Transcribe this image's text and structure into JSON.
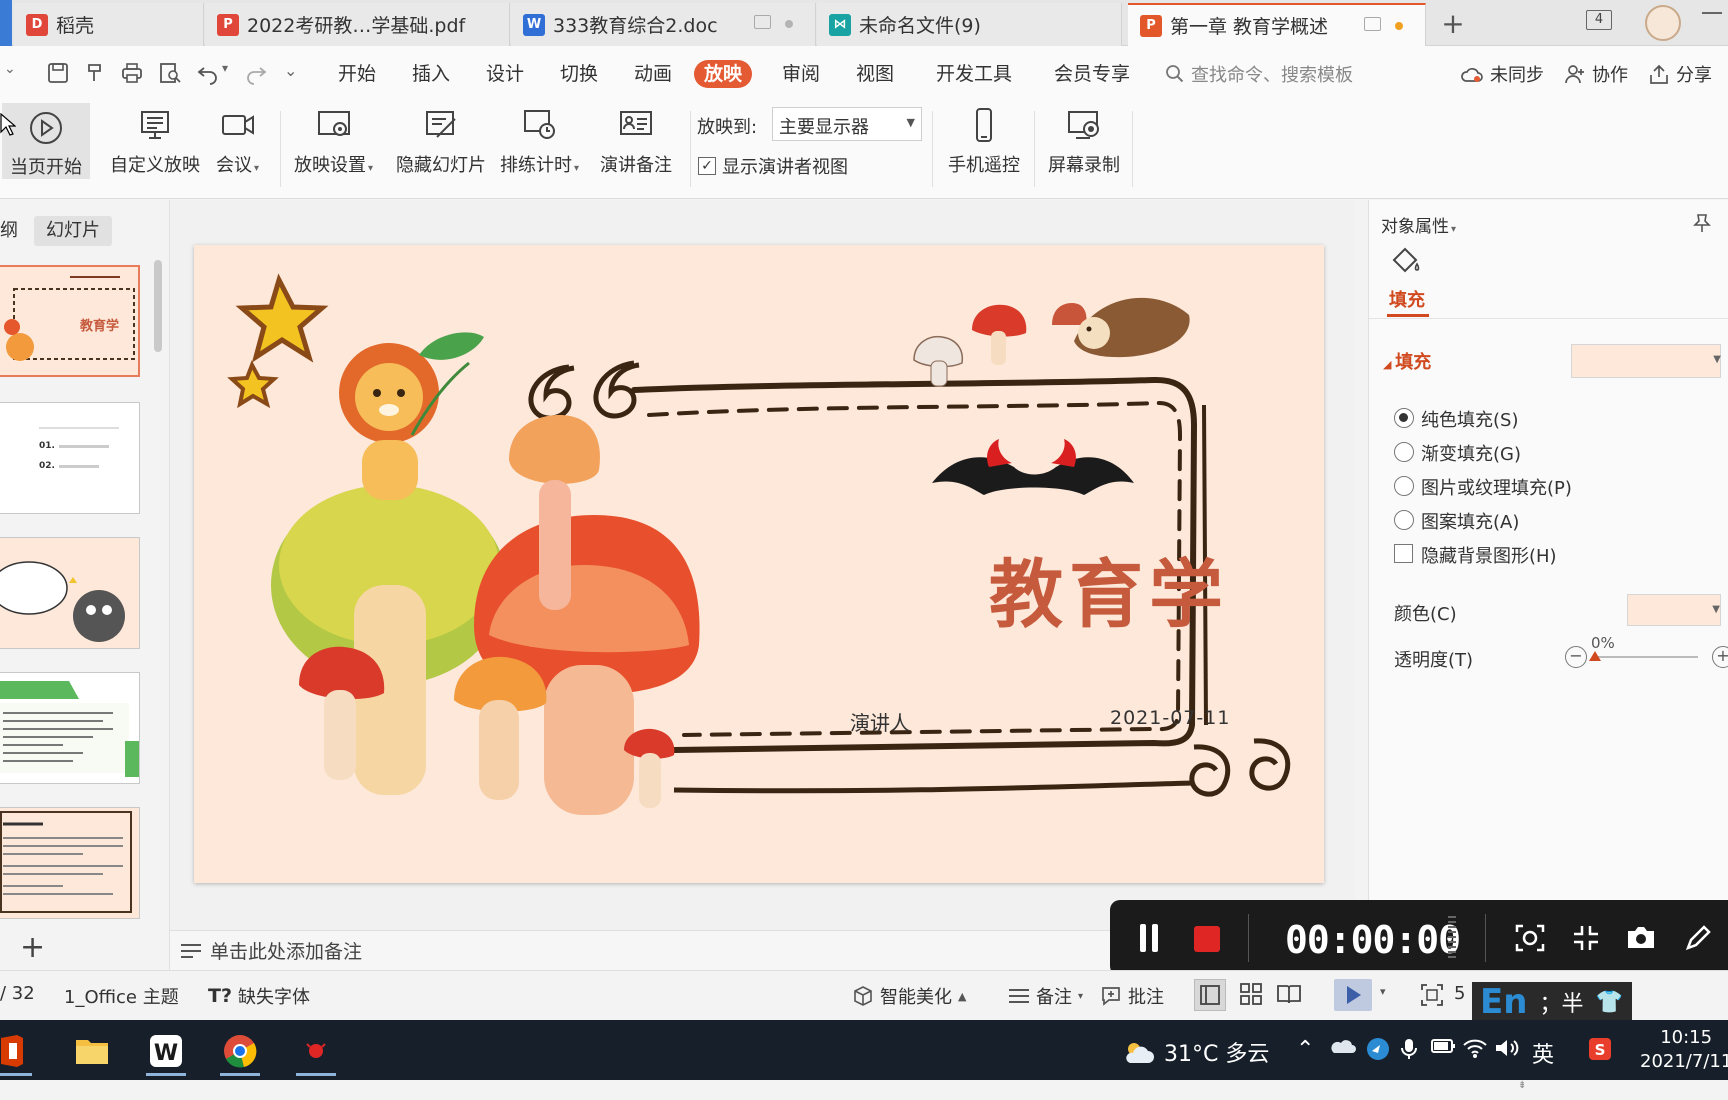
{
  "tabs": [
    {
      "label": "稻壳",
      "icon": "docer-icon",
      "color": "#e0463a"
    },
    {
      "label": "2022考研教…学基础.pdf",
      "icon": "pdf-icon",
      "color": "#e0463a"
    },
    {
      "label": "333教育综合2.doc",
      "icon": "word-icon",
      "color": "#2f6fd6"
    },
    {
      "label": "未命名文件(9)",
      "icon": "mindmap-icon",
      "color": "#1aa3a3"
    },
    {
      "label": "第一章 教育学概述",
      "icon": "ppt-icon",
      "color": "#e3582b"
    }
  ],
  "tab_count": "4",
  "menu": [
    "开始",
    "插入",
    "设计",
    "切换",
    "动画",
    "放映",
    "审阅",
    "视图",
    "开发工具",
    "会员专享"
  ],
  "search_placeholder": "查找命令、搜索模板",
  "top_right": {
    "sync": "未同步",
    "collab": "协作",
    "share": "分享"
  },
  "ribbon": {
    "from_current": "当页开始",
    "custom_show": "自定义放映",
    "meeting": "会议",
    "show_settings": "放映设置",
    "hide_slide": "隐藏幻灯片",
    "rehearse": "排练计时",
    "speaker_notes": "演讲备注",
    "show_to_label": "放映到:",
    "show_to_value": "主要显示器",
    "presenter_view": "显示演讲者视图",
    "phone_remote": "手机遥控",
    "screen_record": "屏幕录制"
  },
  "left_panel": {
    "outline_tab": "纲",
    "slides_tab": "幻灯片"
  },
  "slide": {
    "title": "教育学",
    "presenter": "演讲人",
    "date": "2021-07-11"
  },
  "thumbs": {
    "t1_title": "教育学",
    "t2_item1": "01.",
    "t2_item2": "02."
  },
  "notes_placeholder": "单击此处添加备注",
  "right_panel": {
    "header": "对象属性",
    "fill_tab": "填充",
    "fill_section": "填充",
    "options": [
      "纯色填充(S)",
      "渐变填充(G)",
      "图片或纹理填充(P)",
      "图案填充(A)"
    ],
    "hide_bg": "隐藏背景图形(H)",
    "color_label": "颜色(C)",
    "transparency_label": "透明度(T)",
    "transparency_value": "0%",
    "fill_color": "#fde8da"
  },
  "recorder": {
    "time": "00:00:00"
  },
  "status": {
    "page": "/ 32",
    "theme": "1_Office 主题",
    "missing_font": "缺失字体",
    "beautify": "智能美化",
    "notes": "备注",
    "comment": "批注",
    "zoom_prefix": "5"
  },
  "ime": {
    "lang": "En",
    "punct": "；半"
  },
  "taskbar": {
    "weather": "31°C 多云",
    "lang": "英",
    "time": "10:15",
    "date": "2021/7/11"
  }
}
